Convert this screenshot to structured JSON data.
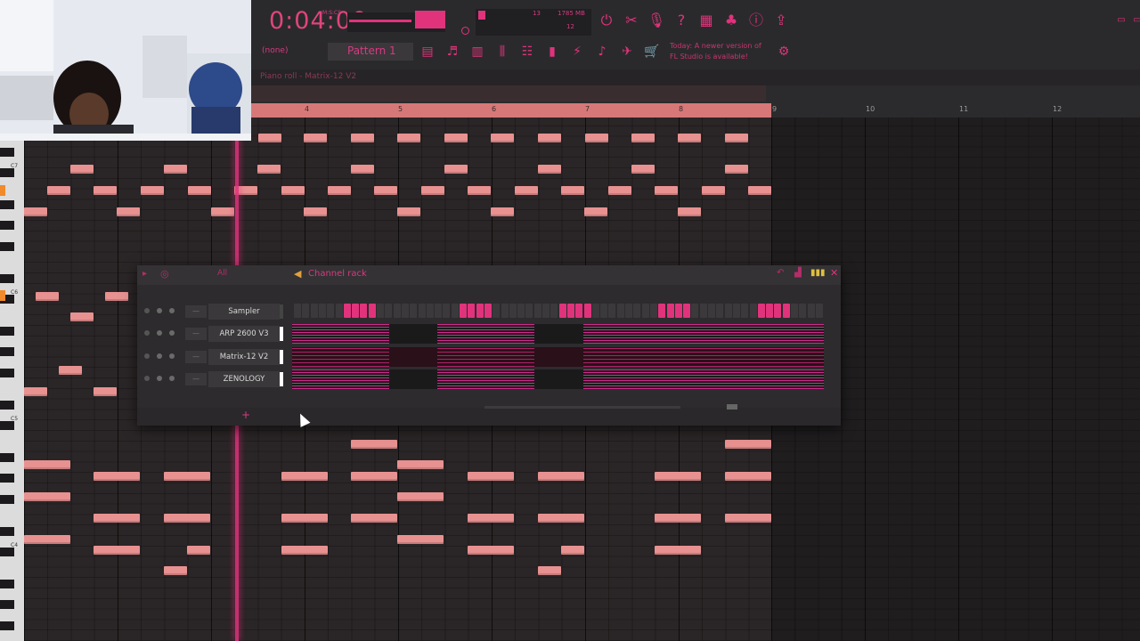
{
  "toolbar": {
    "time": "0:04:00",
    "time_sub": "M:S:CS",
    "cpu_voices": "13",
    "cpu_mem": "1785 MB",
    "cpu_num2": "12",
    "pattern_none": "(none)",
    "pattern": "Pattern 1",
    "news_line1": "Today: A newer version of",
    "news_line2": "FL Studio is available!"
  },
  "piano_roll": {
    "title": "Piano roll - Matrix-12 V2",
    "bars": [
      "4",
      "5",
      "6",
      "7",
      "8",
      "9",
      "10",
      "11",
      "12"
    ],
    "octaves": [
      "C7",
      "C6",
      "C5",
      "C4"
    ]
  },
  "channel_rack": {
    "title": "Channel rack",
    "filter": "All",
    "channels": [
      "Sampler",
      "ARP 2600 V3",
      "Matrix-12 V2",
      "ZENOLOGY"
    ],
    "sampler_steps": [
      0,
      0,
      0,
      0,
      0,
      0,
      1,
      1,
      1,
      1,
      0,
      0,
      0,
      0,
      0,
      0,
      0,
      0,
      0,
      0,
      1,
      1,
      1,
      1,
      0,
      0,
      0,
      0,
      0,
      0,
      0,
      0,
      1,
      1,
      1,
      1,
      0,
      0,
      0,
      0,
      0,
      0,
      0,
      0,
      1,
      1,
      1,
      1,
      0,
      0,
      0,
      0,
      0,
      0,
      0,
      0,
      1,
      1,
      1,
      1,
      0,
      0,
      0,
      0,
      0,
      0,
      0,
      0,
      0,
      0,
      0,
      0
    ]
  },
  "colors": {
    "accent": "#e0337c",
    "note": "#e89191"
  }
}
